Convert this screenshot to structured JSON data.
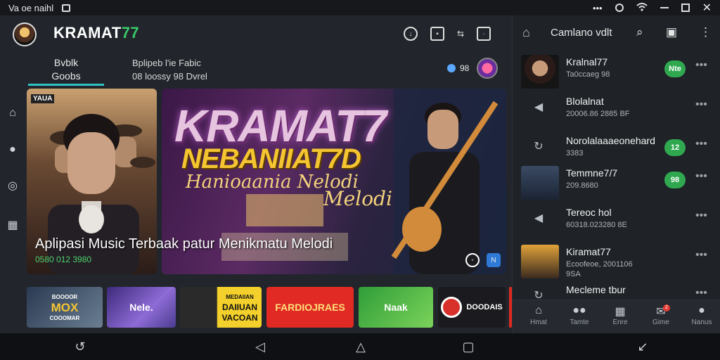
{
  "statusbar": {
    "left_text": "Va oe naihl",
    "right_dots": "•••"
  },
  "appbar": {
    "brand_part1": "KRAMAT",
    "brand_part2": "77"
  },
  "tabs": {
    "tab1_line1": "Bvblk",
    "tab1_line2": "Goobs",
    "tab2_line1": "Bplipeb l'ie Fabic",
    "tab2_line2": "08 loossy 98 Dvrel",
    "stat": "98"
  },
  "hero": {
    "left_label": "YAUA",
    "title_line1": "KRAMAT7",
    "title_line2": "NEBANIIAT7D",
    "title_line3": "Hanioaania Nelodi",
    "title_line4": "Melodi",
    "caption": "Aplipasi Music Terbaak patur Menikmatu Melodi",
    "caption_sub": "0580 012 3980"
  },
  "thumbs": [
    {
      "label": "MOX",
      "sub": "COOOMAR",
      "badge": "BOOOOR"
    },
    {
      "label": "Nele.",
      "sub": ""
    },
    {
      "label": "DAIIUAN VACOAN",
      "sub": "MEDAIIAN"
    },
    {
      "label": "FARDIOJRAES",
      "sub": ""
    },
    {
      "label": "Naak",
      "sub": ""
    },
    {
      "label": "DOODAIS",
      "sub": ""
    }
  ],
  "right": {
    "title": "Camlano vdlt",
    "chats": [
      {
        "name": "Kralnal77",
        "sub": "Ta0ccaeg 98",
        "badge": "Nte"
      },
      {
        "name": "Blolalnat",
        "sub": "20006.86 2885   BF",
        "badge": ""
      },
      {
        "name": "Norolalaaaeonehard",
        "sub": "3383",
        "badge": "12"
      },
      {
        "name": "Temmne7/7",
        "sub": "209.8680",
        "badge": "98"
      },
      {
        "name": "Tereoc hol",
        "sub": "60318.023280   8E",
        "badge": ""
      },
      {
        "name": "Kiramat77",
        "sub": "Ecoofeoe, 2001106",
        "sub2": "9SA",
        "badge": ""
      },
      {
        "name": "Mecleme tbur",
        "sub": "",
        "badge": ""
      }
    ],
    "bottom_tabs": [
      {
        "label": "Hmat"
      },
      {
        "label": "Tamte"
      },
      {
        "label": "Enre"
      },
      {
        "label": "Gime",
        "badge": "2"
      },
      {
        "label": "Nanus"
      }
    ]
  }
}
